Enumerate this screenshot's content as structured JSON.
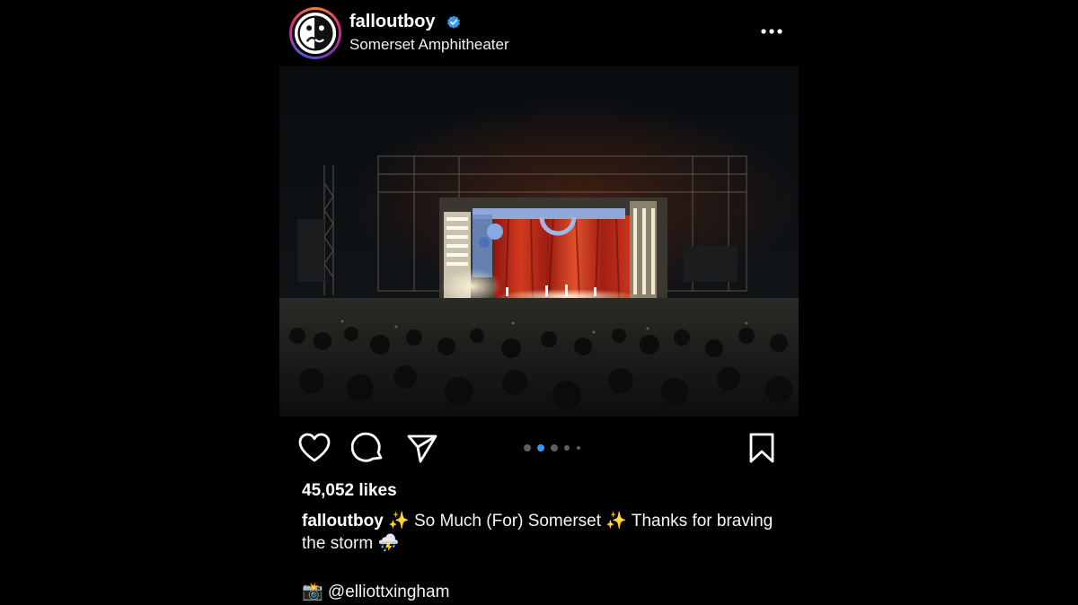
{
  "post": {
    "username": "falloutboy",
    "location": "Somerset Amphitheater",
    "verified_color": "#3897f0",
    "avatar_icon": "fob-sad-face-logo",
    "more_icon": "ellipsis-icon",
    "photo_alt": "concert-stage-photo",
    "carousel": {
      "count": 5,
      "active_index": 1,
      "active_color": "#3897f0"
    },
    "likes": "45,052 likes",
    "caption": {
      "user": "falloutboy",
      "text": "✨ So Much (For) Somerset ✨ Thanks for braving the storm ⛈️"
    },
    "credit": "📸 @elliottxingham"
  },
  "actions": {
    "like_icon": "heart-icon",
    "comment_icon": "comment-icon",
    "share_icon": "send-icon",
    "save_icon": "bookmark-icon"
  }
}
